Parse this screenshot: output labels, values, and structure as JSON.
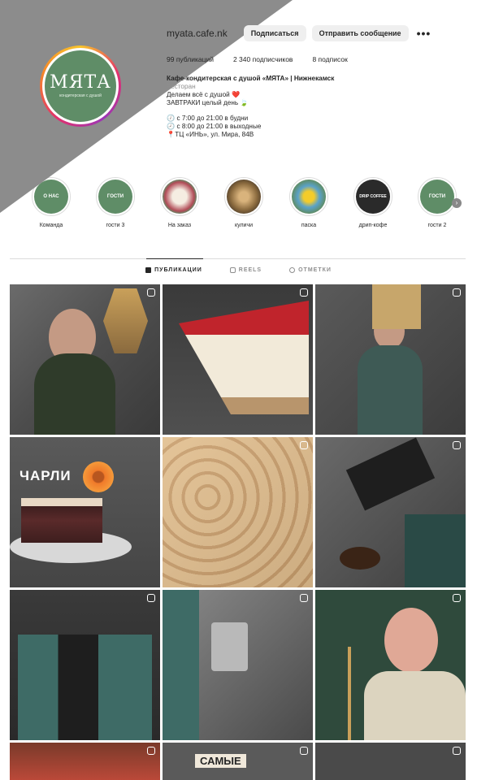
{
  "profile": {
    "username": "myata.cafe.nk",
    "subscribe_label": "Подписаться",
    "message_label": "Отправить сообщение",
    "more_label": "•••",
    "logo_text": "МЯТА",
    "logo_sub": "кондитерская с душой",
    "stats": {
      "posts": "99 публикаций",
      "followers": "2 340 подписчиков",
      "following": "8 подписок"
    },
    "bio": {
      "name": "Кафе-кондитерская с душой «МЯТА» | Нижнекамск",
      "category": "Ресторан",
      "line1": "Делаем всё с душой ❤️",
      "line2": "ЗАВТРАКИ целый день 🍃",
      "hours1": "🕖 с 7:00 до 21:00 в будни",
      "hours2": "🕗 с 8:00 до 21:00 в выходные",
      "address": "📍ТЦ «ИНЬ», ул. Мира, 84В"
    }
  },
  "highlights": [
    {
      "label": "Команда",
      "icon_text": "О НАС"
    },
    {
      "label": "гости 3",
      "icon_text": "ГОСТИ"
    },
    {
      "label": "На заказ",
      "icon_text": ""
    },
    {
      "label": "куличи",
      "icon_text": ""
    },
    {
      "label": "паска",
      "icon_text": ""
    },
    {
      "label": "дрип-кофе",
      "icon_text": "DRIP COFFEE"
    },
    {
      "label": "гости 2",
      "icon_text": "ГОСТИ"
    }
  ],
  "tabs": {
    "posts": "ПУБЛИКАЦИИ",
    "reels": "REELS",
    "tagged": "ОТМЕТКИ"
  },
  "posts": {
    "charli_caption": "ЧАРЛИ",
    "samye_caption": "САМЫЕ"
  }
}
